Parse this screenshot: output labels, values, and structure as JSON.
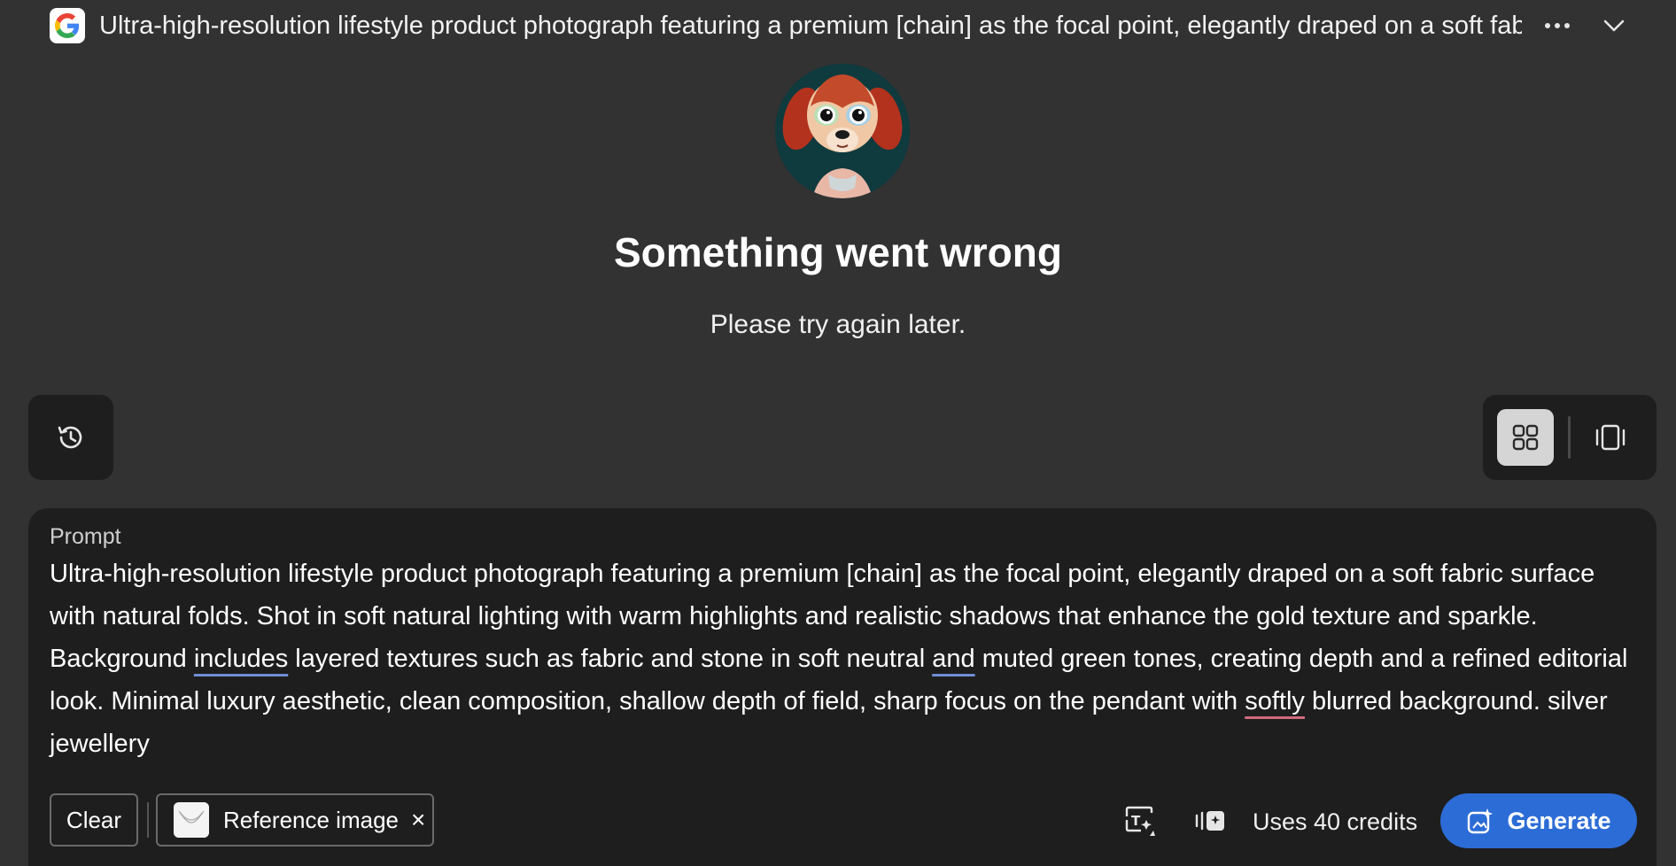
{
  "header": {
    "title": "Ultra-high-resolution lifestyle product photograph featuring a premium [chain] as the focal point, elegantly draped on a soft fabric surface with natural folds.",
    "logo_icon": "google-g-icon",
    "more_icon": "ellipsis-icon",
    "expand_icon": "chevron-down-icon"
  },
  "error": {
    "title": "Something went wrong",
    "message": "Please try again later."
  },
  "toolbar": {
    "history_icon": "history-icon",
    "grid_view_icon": "grid-view-icon",
    "single_view_icon": "single-view-icon"
  },
  "prompt": {
    "label": "Prompt",
    "segments": [
      "Ultra-high-resolution lifestyle product photograph featuring a premium [chain] as the focal point, elegantly draped on a soft fabric surface with natural folds. Shot in soft natural lighting with warm highlights and realistic shadows that enhance the gold texture and sparkle. Background ",
      "includes",
      " layered textures such as fabric and stone in soft neutral ",
      "and",
      " muted green tones, creating depth and a refined editorial look. Minimal luxury aesthetic, clean composition, shallow depth of field, sharp focus on the pendant with ",
      "softly",
      " blurred background. silver jewellery"
    ]
  },
  "footer": {
    "clear_label": "Clear",
    "reference_label": "Reference image",
    "reference_close": "×",
    "credits_label": "Uses 40 credits",
    "generate_label": "Generate",
    "style_icon": "text-effects-icon",
    "reference_toggle_icon": "composition-reference-icon",
    "generate_icon": "sparkle-image-icon"
  },
  "colors": {
    "background": "#323232",
    "panel": "#1e1e1e",
    "accent": "#2c6cd6"
  }
}
